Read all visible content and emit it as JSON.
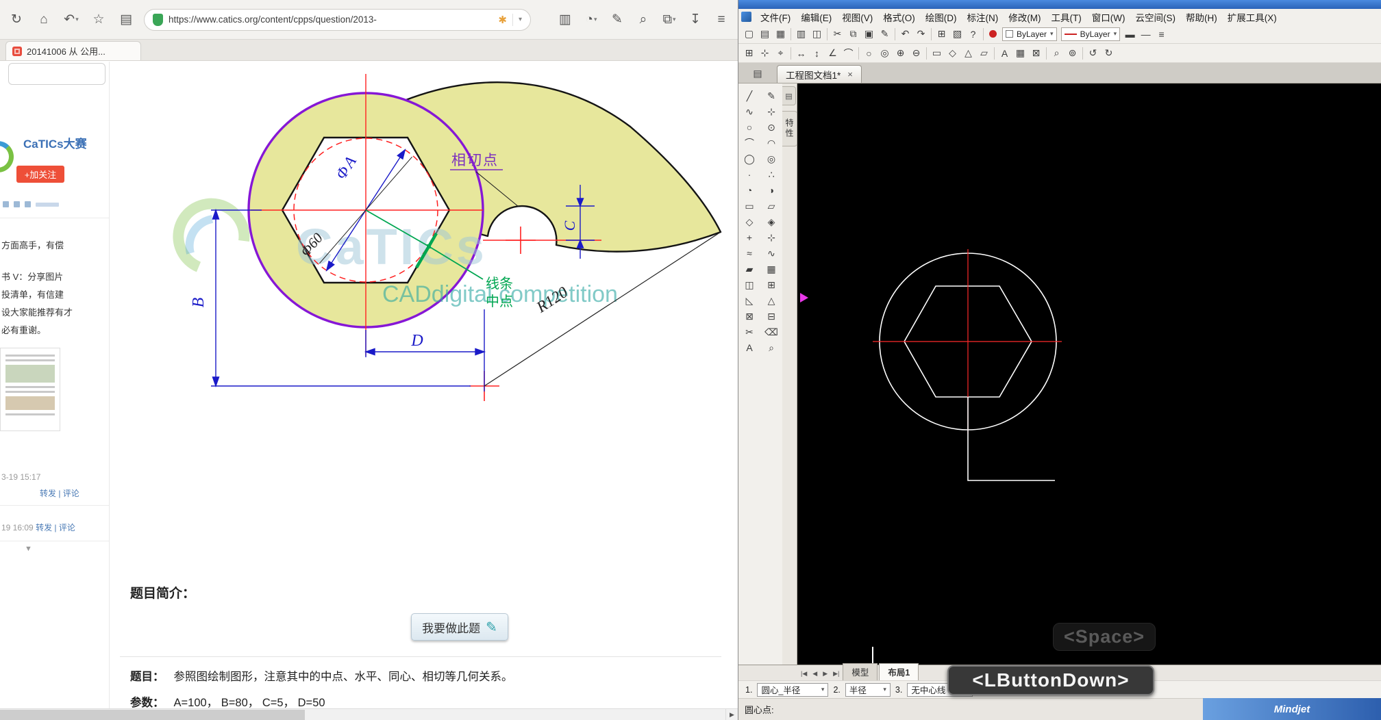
{
  "browser": {
    "toolbar": {
      "url": "https://www.catics.org/content/cpps/question/2013-",
      "icons": [
        "reload",
        "home",
        "back",
        "favorites-star",
        "notes",
        "site-safety",
        "extension-bee",
        "url-dropdown",
        "print",
        "history",
        "edit-tools",
        "search",
        "windows",
        "download",
        "menu"
      ]
    },
    "tab": {
      "title": "20141006 从 公用..."
    },
    "sidebar": {
      "brand": "CaTICs大赛",
      "follow_button": "+加关注",
      "post1_line": "方面高手，有偿",
      "post2_lines": [
        "书 V：分享图片",
        "投清单，有信建",
        "设大家能推荐有才",
        "必有重谢。"
      ],
      "time1": "3-19 15:17",
      "links1": "转发 | 评论",
      "time2": "19 16:09",
      "links2": "转发 | 评论"
    },
    "question": {
      "intro_label": "题目简介：",
      "do_button": "我要做此题",
      "title_label": "题目：",
      "title_text": "参照图绘制图形，注意其中的中点、水平、同心、相切等几何关系。",
      "params_label": "参数：",
      "params_text": "A=100， B=80， C=5， D=50"
    },
    "drawing": {
      "dims": {
        "phi_a": "ΦA",
        "phi_60": "Φ60",
        "b": "B",
        "c": "C",
        "d": "D",
        "r120": "R120"
      },
      "labels": {
        "tangent_point": "相切点",
        "line_mid_1": "线条",
        "line_mid_2": "中点"
      },
      "watermark": {
        "big": "CaTICs",
        "sub": "CADdigital competition"
      },
      "colors": {
        "fill_yellow": "#e7e79c",
        "outline_purple": "#8617d6",
        "dimension_blue": "#1a1ac8",
        "centerline_red": "#ff2020",
        "midpoint_green": "#00a651",
        "tangent_purple": "#7b2fbe"
      }
    }
  },
  "cad": {
    "menu": [
      "文件(F)",
      "编辑(E)",
      "视图(V)",
      "格式(O)",
      "绘图(D)",
      "标注(N)",
      "修改(M)",
      "工具(T)",
      "窗口(W)",
      "云空间(S)",
      "帮助(H)",
      "扩展工具(X)"
    ],
    "toolbar": {
      "color_style": "ByLayer",
      "line_style": "ByLayer"
    },
    "doc_tab": "工程图文档1*",
    "doc_tab_close": "×",
    "side_tab": "特性",
    "canvas_hints": {
      "space": "<Space>",
      "lbutton": "<LButtonDown>"
    },
    "sheet_tabs": [
      "模型",
      "布局1"
    ],
    "options": [
      {
        "num": "1.",
        "value": "圆心_半径"
      },
      {
        "num": "2.",
        "value": "半径"
      },
      {
        "num": "3.",
        "value": "无中心线"
      }
    ],
    "status_prompt": "圆心点:",
    "watermark": "Mindjet",
    "colors": {
      "canvas_bg": "#000000",
      "geometry": "#ffffff",
      "centerline": "#ff2a2a"
    }
  }
}
